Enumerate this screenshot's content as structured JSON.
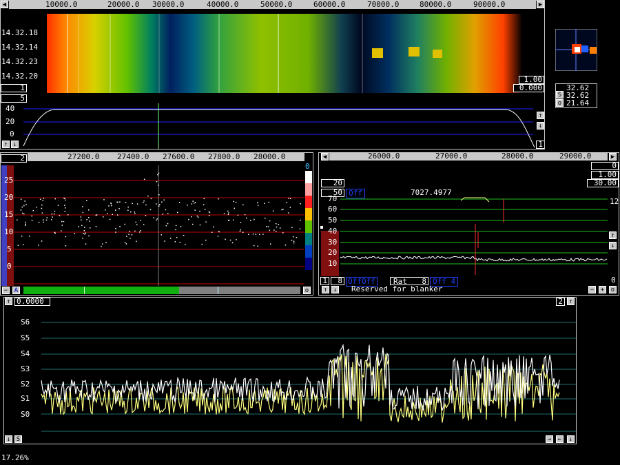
{
  "top_panel": {
    "freq_ticks": [
      "10000.0",
      "20000.0",
      "30000.0",
      "40000.0",
      "50000.0",
      "60000.0",
      "70000.0",
      "80000.0",
      "90000.0"
    ],
    "timestamps": [
      "14.32.18",
      "14.32.14",
      "14.32.23",
      "14.32.20"
    ],
    "left_box": "1",
    "left_box2": "5",
    "right_box1": "1.00",
    "right_box2": "0.000",
    "spectrum_y": [
      "40",
      "20",
      "0"
    ],
    "bottom_right_box": "1"
  },
  "mini_panel": {
    "values": [
      "32.62",
      "32.62",
      "21.64"
    ],
    "labels": [
      "S",
      "o"
    ]
  },
  "mid_left": {
    "box": "2",
    "freq_ticks": [
      "27200.0",
      "27400.0",
      "27600.0",
      "27800.0",
      "28000.0"
    ],
    "y_ticks": [
      "25",
      "20",
      "15",
      "10",
      "5",
      "0"
    ],
    "corner_value": "0",
    "a_label": "A",
    "o_label": "o",
    "minus_label": "−"
  },
  "mid_right": {
    "freq_ticks": [
      "26000.0",
      "27000.0",
      "28000.0",
      "29000.0"
    ],
    "box_0": "0",
    "box_1": "1.00",
    "box_20": "20",
    "box_30": "30.00",
    "box_50": "50",
    "off_tag": "Off",
    "freq_readout": "7027.4977",
    "y_ticks": [
      "70",
      "60",
      "50",
      "40",
      "30",
      "20",
      "10"
    ],
    "right_top": "12",
    "right_bottom": "0",
    "bottom_box1": "1",
    "bottom_box8": "8",
    "off_off": "OffOff",
    "rat_label": "Rat",
    "rat_value": "8",
    "off_4": "Off  4",
    "reserved_text": "Reserved for blanker"
  },
  "bottom_panel": {
    "value_box": "0.0000",
    "corner_box": "2",
    "s_labels": [
      "S6",
      "S5",
      "S4",
      "S3",
      "S2",
      "S1",
      "S0"
    ],
    "s_button": "S",
    "o_button": "o"
  },
  "status": {
    "percent": "17.26%"
  },
  "colors": {
    "accent_green": "#00ff00",
    "panel_gray": "#c8c8c8",
    "trace_yellow": "#ffff80",
    "marker_red": "#ff3030",
    "blue_line": "#2020ff"
  }
}
